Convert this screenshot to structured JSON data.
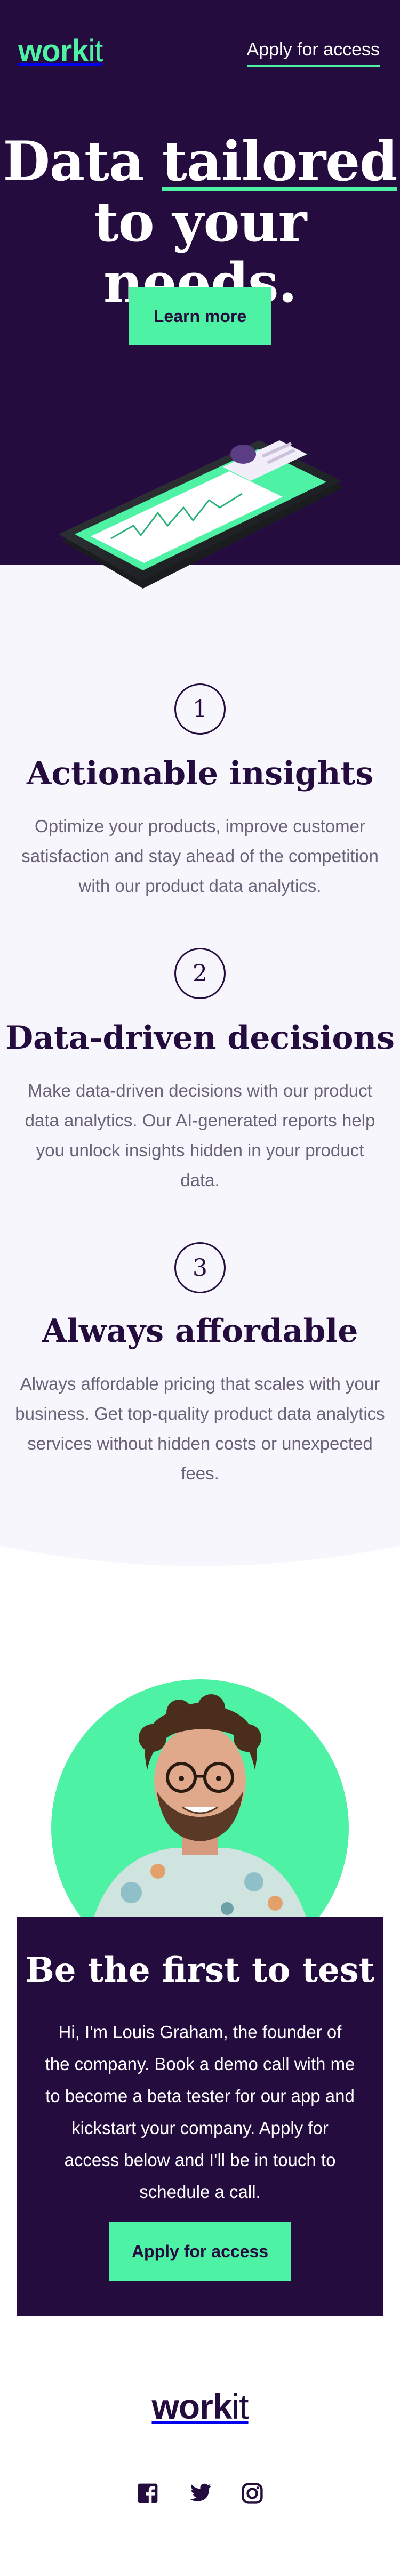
{
  "header": {
    "logo_work": "work",
    "logo_it": "it",
    "apply_link": "Apply for access"
  },
  "hero": {
    "title_line1_pre": "Data ",
    "title_line1_emph": "tailored",
    "title_line2": "to your needs.",
    "cta_label": "Learn more"
  },
  "features": [
    {
      "number": "1",
      "title": "Actionable insights",
      "body": "Optimize your products, improve customer satisfaction and stay ahead of the competition with our product data analytics."
    },
    {
      "number": "2",
      "title": "Data-driven decisions",
      "body": "Make data-driven decisions with our product data analytics. Our AI-generated reports help you unlock insights hidden in your product data."
    },
    {
      "number": "3",
      "title": "Always affordable",
      "body": "Always affordable pricing that scales with your business. Get top-quality product data analytics services without hidden costs or unexpected fees."
    }
  ],
  "founder": {
    "heading": "Be the first to test",
    "text": "Hi, I'm Louis Graham, the founder of the company. Book a demo call with me to become a beta tester for our app and kickstart your company. Apply for access below and I'll be in touch to schedule a call.",
    "cta_label": "Apply for access"
  },
  "footer": {
    "logo_work": "work",
    "logo_it": "it",
    "social_icons": [
      "facebook-icon",
      "twitter-icon",
      "instagram-icon"
    ]
  },
  "colors": {
    "brand_dark": "#250c3e",
    "accent_green": "#4ef2a4",
    "feature_bg": "#f8f6fd",
    "body_text": "#6a6378"
  }
}
